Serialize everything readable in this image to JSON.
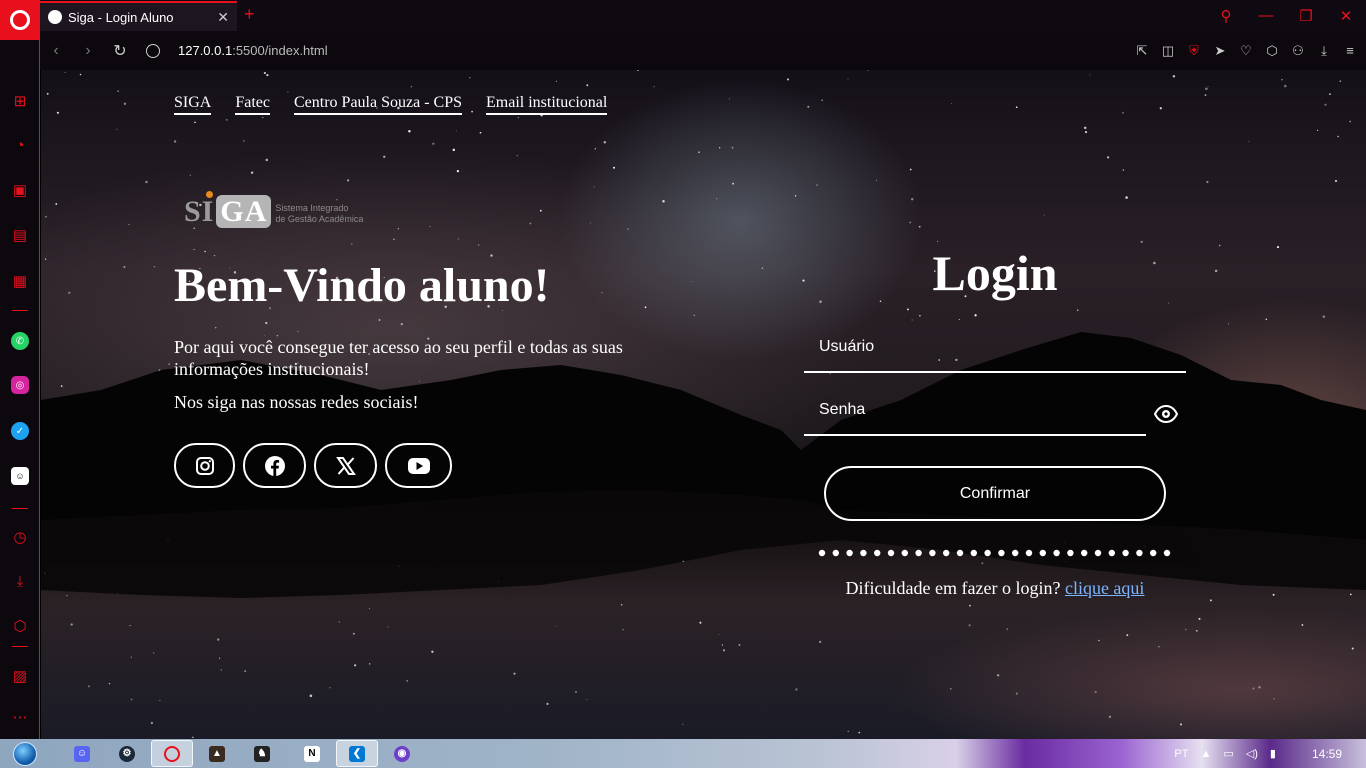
{
  "browser": {
    "tab_title": "Siga - Login Aluno",
    "tab_close": "✕",
    "new_tab": "+",
    "url_host": "127.0.0.1",
    "url_rest": ":5500/index.html",
    "accent": "#e8101d"
  },
  "nav": {
    "links": [
      "SIGA",
      "Fatec",
      "Centro Paula Souza - CPS",
      "Email institucional"
    ]
  },
  "logo": {
    "mark_prefix": "SI",
    "mark_box": "GA",
    "sub_line1": "Sistema Integrado",
    "sub_line2": "de Gestão Acadêmica"
  },
  "hero": {
    "title": "Bem-Vindo aluno!",
    "description": "Por aqui você consegue ter acesso ao seu perfil e todas as suas informações institucionais!",
    "social_prompt": "Nos siga nas nossas redes sociais!"
  },
  "socials": [
    {
      "name": "instagram-icon"
    },
    {
      "name": "facebook-icon"
    },
    {
      "name": "x-twitter-icon"
    },
    {
      "name": "youtube-icon"
    }
  ],
  "login": {
    "title": "Login",
    "user_placeholder": "Usuário",
    "password_placeholder": "Senha",
    "confirm_label": "Confirmar",
    "help_text": "Dificuldade em fazer o login?",
    "help_link": "clique aqui",
    "link_color": "#7cb6ff"
  },
  "taskbar": {
    "language": "PT",
    "clock": "14:59"
  }
}
